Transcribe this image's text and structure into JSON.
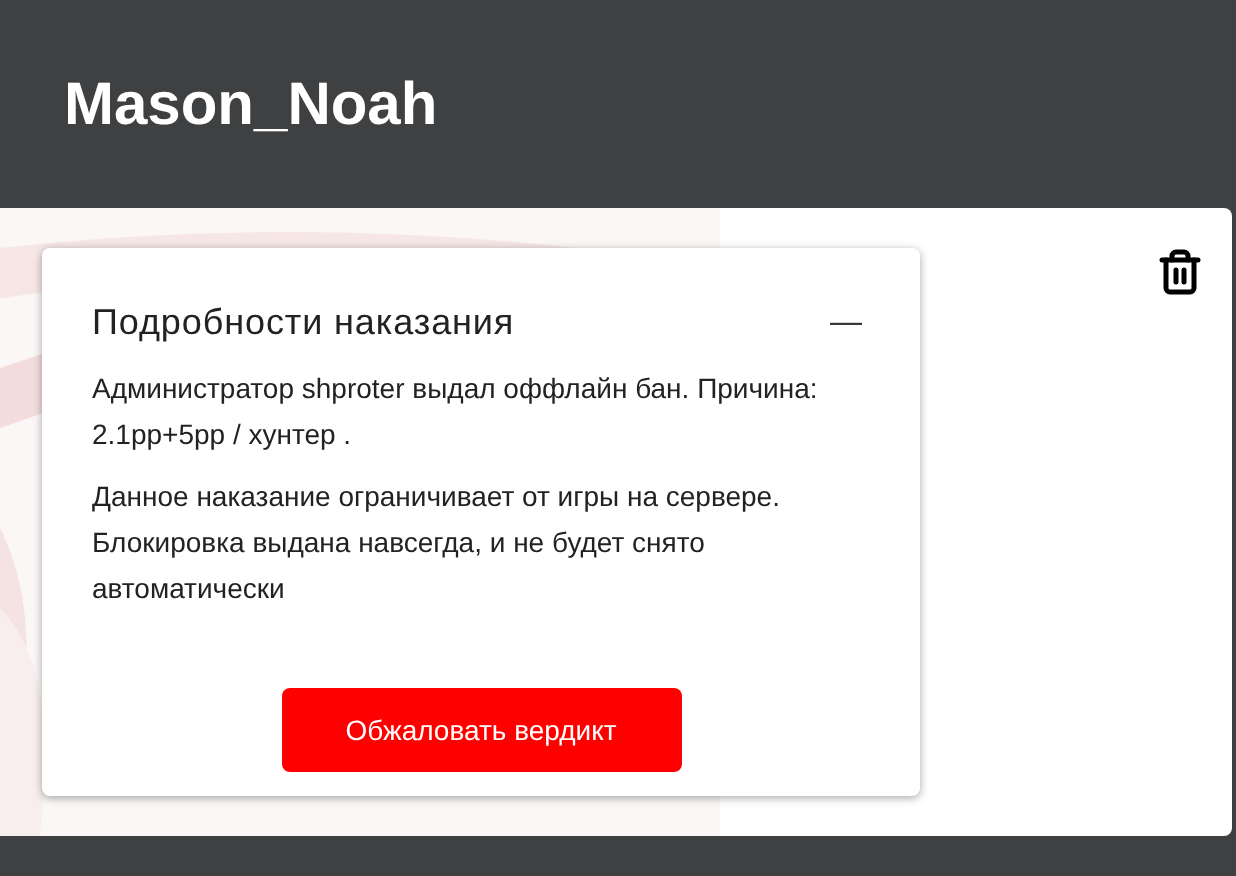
{
  "header": {
    "title": "Mason_Noah"
  },
  "punishment": {
    "title": "Подробности наказания",
    "collapse_symbol": "—",
    "paragraphs": [
      "Администратор shproter выдал оффлайн бан. Причина: 2.1рр+5рр / хунтер .",
      "Данное наказание ограничивает от игры на сервере. Блокировка выдана навсегда, и не будет снято автоматически"
    ],
    "button": "Обжаловать вердикт"
  }
}
